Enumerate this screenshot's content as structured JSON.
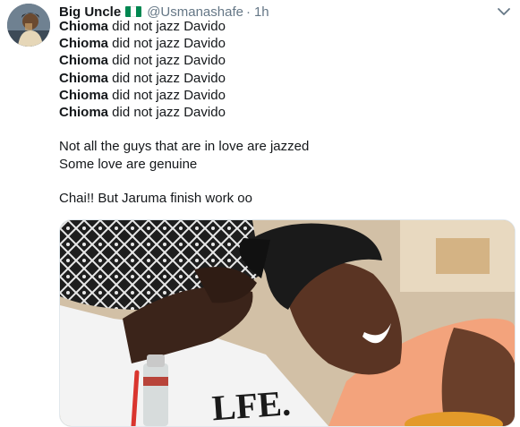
{
  "tweet": {
    "display_name": "Big Uncle",
    "handle": "@Usmanashafe",
    "separator": "·",
    "time": "1h",
    "lines": [
      {
        "bold": "Chioma",
        "rest": " did not jazz Davido"
      },
      {
        "bold": "Chioma",
        "rest": " did not jazz Davido"
      },
      {
        "bold": "Chioma",
        "rest": " did not jazz Davido"
      },
      {
        "bold": "Chioma",
        "rest": " did not jazz Davido"
      },
      {
        "bold": "Chioma",
        "rest": " did not jazz Davido"
      },
      {
        "bold": "Chioma",
        "rest": " did not jazz Davido"
      }
    ],
    "paragraph_2": [
      "Not all the guys that are in love are jazzed",
      "Some love are genuine"
    ],
    "paragraph_3": "Chai!! But Jaruma finish work oo",
    "shirt_text": "LFE."
  },
  "icons": {
    "flag": "nigeria-flag-icon",
    "menu": "chevron-down-icon"
  },
  "colors": {
    "flag_green": "#008751",
    "flag_white": "#ffffff",
    "secondary_text": "#657786",
    "primary_text": "#14171a"
  }
}
